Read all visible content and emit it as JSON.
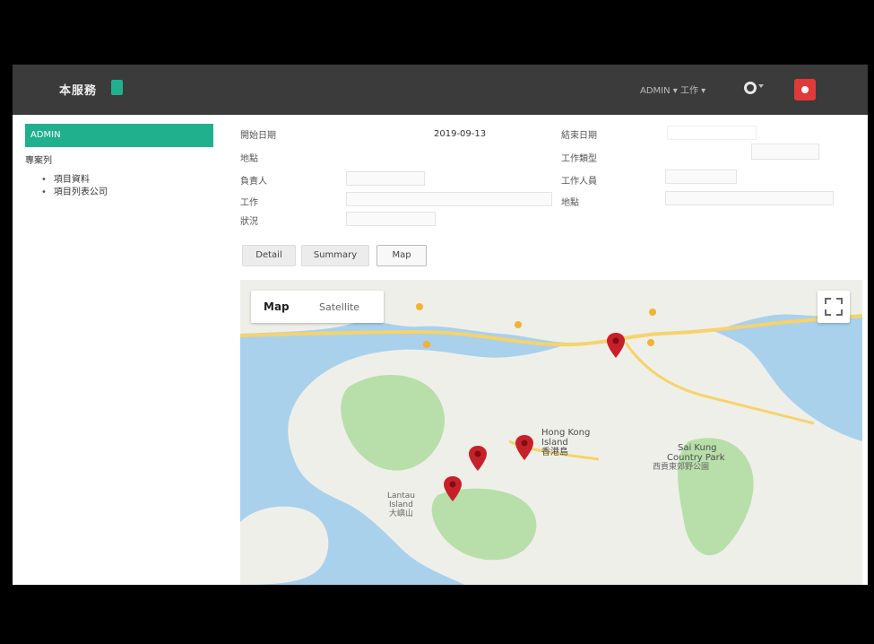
{
  "header": {
    "brand": "本服務",
    "user_info": "ADMIN ▾ 工作 ▾",
    "lang_icon": "globe-flag-icon",
    "logout_icon": "power-icon"
  },
  "sidebar": {
    "active_item": "ADMIN",
    "group_label": "專案列",
    "sub_items": [
      "項目資料",
      "項目列表公司"
    ]
  },
  "form": {
    "labels_left": [
      "開始日期",
      "地點",
      "負責人",
      "工作",
      "狀況"
    ],
    "date_value": "2019-09-13",
    "labels_right": [
      "結束日期",
      "工作類型",
      "工作人員",
      "地點"
    ],
    "fields": {
      "owner": "",
      "work": "",
      "status": "",
      "end_date": "",
      "work_type": "",
      "staff": "",
      "location": ""
    }
  },
  "tabs": [
    "Detail",
    "Summary",
    "Map"
  ],
  "map": {
    "type_map": "Map",
    "type_satellite": "Satellite",
    "labels": {
      "hk": "Hong Kong",
      "hk2": "Island",
      "hk_cn": "香港島",
      "park": "Sai Kung",
      "park2": "Country Park",
      "park_cn": "西貢東郊野公園",
      "lantau": "Lantau",
      "lantau2": "Island",
      "lantau_cn": "大嶼山"
    },
    "water_color": "#a9d1ec",
    "land_color": "#efefea",
    "park_color": "#b8dfa9",
    "marker_color": "#c8202a"
  }
}
